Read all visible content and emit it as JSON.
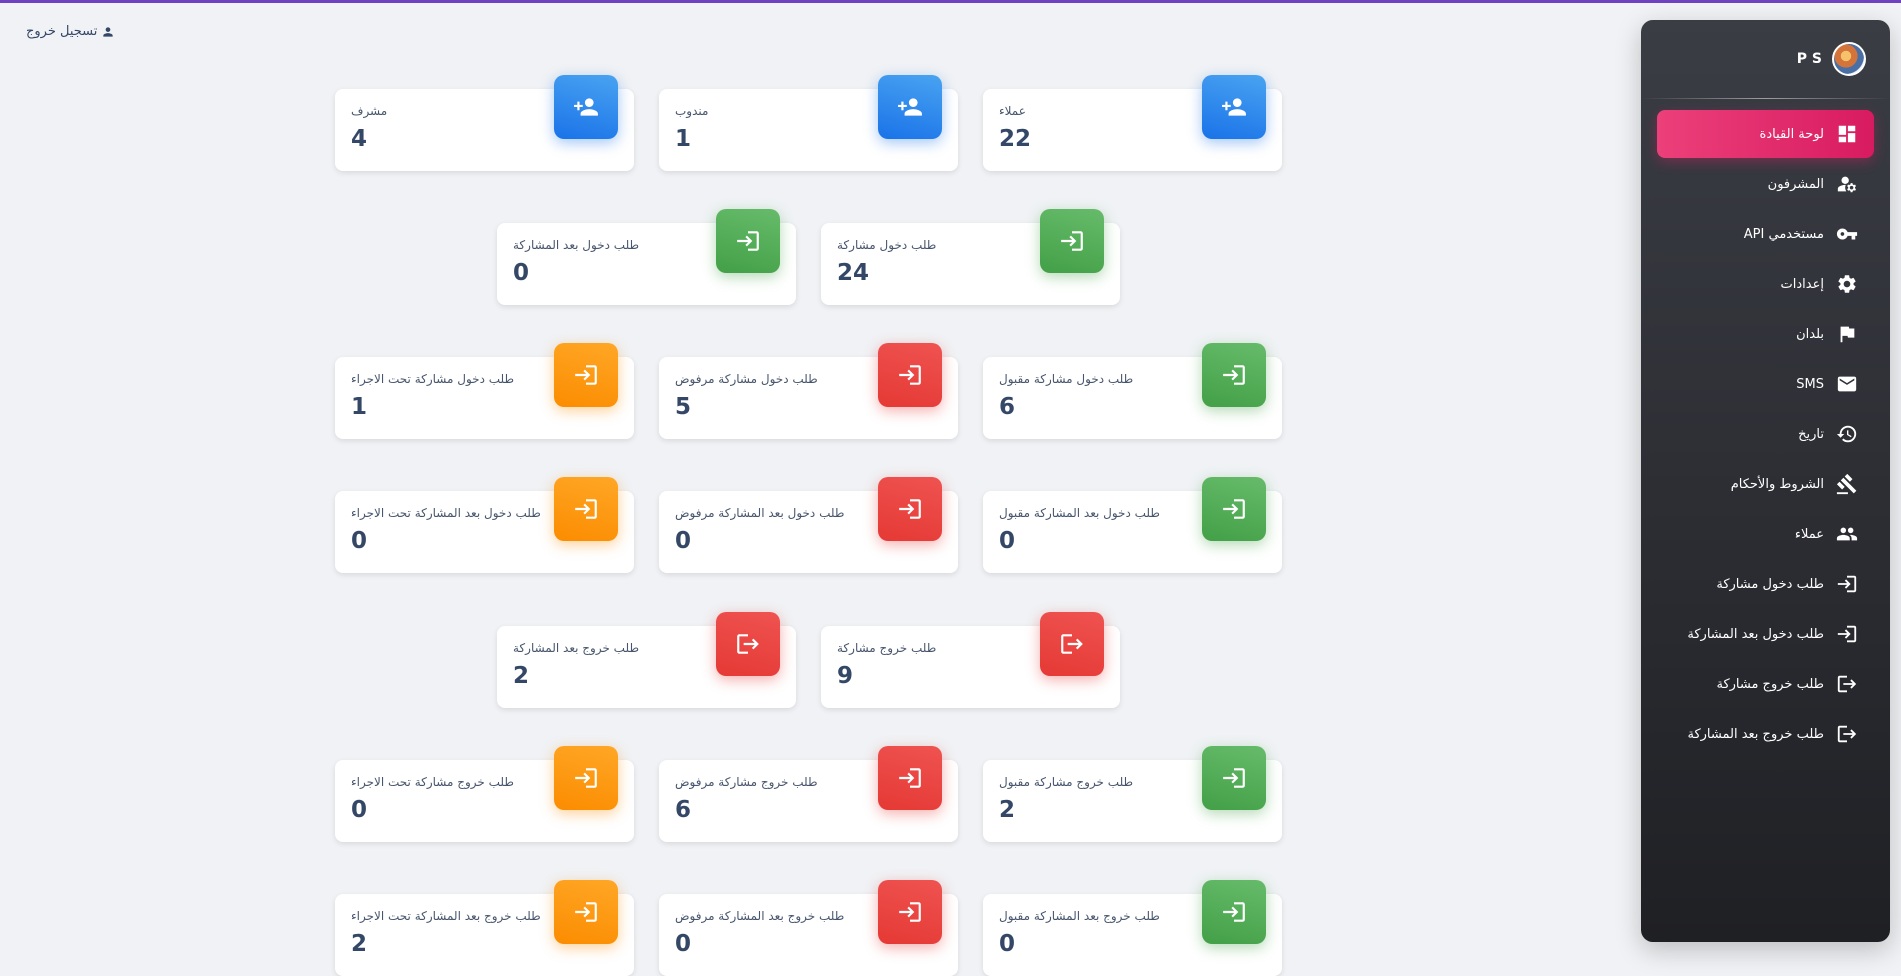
{
  "header": {
    "logout_label": "تسجيل خروج"
  },
  "sidebar": {
    "brand": "P S",
    "items": [
      {
        "label": "لوحة القيادة",
        "icon": "dashboard-icon",
        "active": true
      },
      {
        "label": "المشرفون",
        "icon": "manage-accounts-icon"
      },
      {
        "label": "مستخدمي API",
        "icon": "key-icon"
      },
      {
        "label": "إعدادات",
        "icon": "gear-icon"
      },
      {
        "label": "بلدان",
        "icon": "flag-icon"
      },
      {
        "label": "SMS",
        "icon": "mail-icon"
      },
      {
        "label": "تاريخ",
        "icon": "history-icon"
      },
      {
        "label": "الشروط والأحكام",
        "icon": "gavel-icon"
      },
      {
        "label": "عملاء",
        "icon": "people-icon"
      },
      {
        "label": "طلب دخول مشاركة",
        "icon": "login-icon"
      },
      {
        "label": "طلب دخول بعد المشاركة",
        "icon": "login-icon"
      },
      {
        "label": "طلب خروج مشاركة",
        "icon": "logout-icon"
      },
      {
        "label": "طلب خروج بعد المشاركة",
        "icon": "logout-icon"
      }
    ]
  },
  "stats": {
    "supervisor": {
      "label": "مشرف",
      "value": "4",
      "color": "#1a73e8",
      "icon": "person-add-icon"
    },
    "agent": {
      "label": "مندوب",
      "value": "1",
      "color": "#1a73e8",
      "icon": "person-add-icon"
    },
    "clients": {
      "label": "عملاء",
      "value": "22",
      "color": "#1a73e8",
      "icon": "person-add-icon"
    },
    "entry_after": {
      "label": "طلب دخول بعد المشاركة",
      "value": "0",
      "color": "#43a047",
      "icon": "login-icon"
    },
    "entry": {
      "label": "طلب دخول مشاركة",
      "value": "24",
      "color": "#43a047",
      "icon": "login-icon"
    },
    "entry_pending": {
      "label": "طلب دخول مشاركة تحت الاجراء",
      "value": "1",
      "color": "#fb8c00",
      "icon": "login-icon"
    },
    "entry_rejected": {
      "label": "طلب دخول مشاركة مرفوض",
      "value": "5",
      "color": "#e53935",
      "icon": "login-icon"
    },
    "entry_accepted": {
      "label": "طلب دخول مشاركة مقبول",
      "value": "6",
      "color": "#43a047",
      "icon": "login-icon"
    },
    "entry_after_pending": {
      "label": "طلب دخول بعد المشاركة تحت الاجراء",
      "value": "0",
      "color": "#fb8c00",
      "icon": "login-icon"
    },
    "entry_after_rejected": {
      "label": "طلب دخول بعد المشاركة مرفوض",
      "value": "0",
      "color": "#e53935",
      "icon": "login-icon"
    },
    "entry_after_accepted": {
      "label": "طلب دخول بعد المشاركة مقبول",
      "value": "0",
      "color": "#43a047",
      "icon": "login-icon"
    },
    "exit_after": {
      "label": "طلب خروج بعد المشاركة",
      "value": "2",
      "color": "#e53935",
      "icon": "logout-icon"
    },
    "exit": {
      "label": "طلب خروج مشاركة",
      "value": "9",
      "color": "#e53935",
      "icon": "logout-icon"
    },
    "exit_pending": {
      "label": "طلب خروج مشاركة تحت الاجراء",
      "value": "0",
      "color": "#fb8c00",
      "icon": "login-icon"
    },
    "exit_rejected": {
      "label": "طلب خروج مشاركة مرفوض",
      "value": "6",
      "color": "#e53935",
      "icon": "login-icon"
    },
    "exit_accepted": {
      "label": "طلب خروج مشاركة مقبول",
      "value": "2",
      "color": "#43a047",
      "icon": "login-icon"
    },
    "exit_after_pending": {
      "label": "طلب خروج بعد المشاركة تحت الاجراء",
      "value": "2",
      "color": "#fb8c00",
      "icon": "login-icon"
    },
    "exit_after_rejected": {
      "label": "طلب خروج بعد المشاركة مرفوض",
      "value": "0",
      "color": "#e53935",
      "icon": "login-icon"
    },
    "exit_after_accepted": {
      "label": "طلب خروج بعد المشاركة مقبول",
      "value": "0",
      "color": "#43a047",
      "icon": "login-icon"
    }
  }
}
